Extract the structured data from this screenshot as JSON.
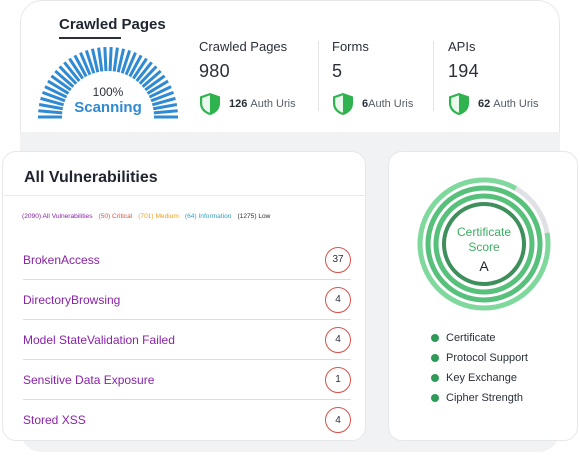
{
  "crawl": {
    "title": "Crawled Pages",
    "percent": "100%",
    "status": "Scanning",
    "progress": 1.0
  },
  "stats": [
    {
      "label": "Crawled Pages",
      "value": "980",
      "auth_count": "126",
      "auth_label": "Auth Uris"
    },
    {
      "label": "Forms",
      "value": "5",
      "auth_count": "6",
      "auth_label": "Auth Uris"
    },
    {
      "label": "APIs",
      "value": "194",
      "auth_count": "62",
      "auth_label": "Auth Uris"
    }
  ],
  "vulnerabilities": {
    "title": "All Vulnerabilities",
    "legend": [
      {
        "text": "(2090) All Vulnerabilities",
        "color": "#8a22a8"
      },
      {
        "text": "(50) Critical",
        "color": "#e0513f"
      },
      {
        "text": "(701) Medium",
        "color": "#e8a31b"
      },
      {
        "text": "(64) Information",
        "color": "#2fa2c4"
      },
      {
        "text": "(1275) Low",
        "color": "#2a2f3a"
      }
    ],
    "items": [
      {
        "name": "BrokenAccess",
        "count": "37"
      },
      {
        "name": "DirectoryBrowsing",
        "count": "4"
      },
      {
        "name": "Model StateValidation Failed",
        "count": "4"
      },
      {
        "name": "Sensitive Data Exposure",
        "count": "1"
      },
      {
        "name": "Stored XSS",
        "count": "4"
      }
    ]
  },
  "certificate": {
    "title_line1": "Certificate",
    "title_line2": "Score",
    "grade": "A",
    "items": [
      "Certificate",
      "Protocol Support",
      "Key Exchange",
      "Cipher Strength"
    ],
    "colors": {
      "ring_light": "#7fd99c",
      "ring_mid": "#57c17b",
      "ring_dark": "#3f8f5c",
      "ring_track": "#dfe1e4"
    }
  },
  "colors": {
    "accent_blue": "#2f8ad3",
    "shield_green": "#2fb34f",
    "vuln_purple": "#8a22a8",
    "count_red": "#d9504a"
  }
}
